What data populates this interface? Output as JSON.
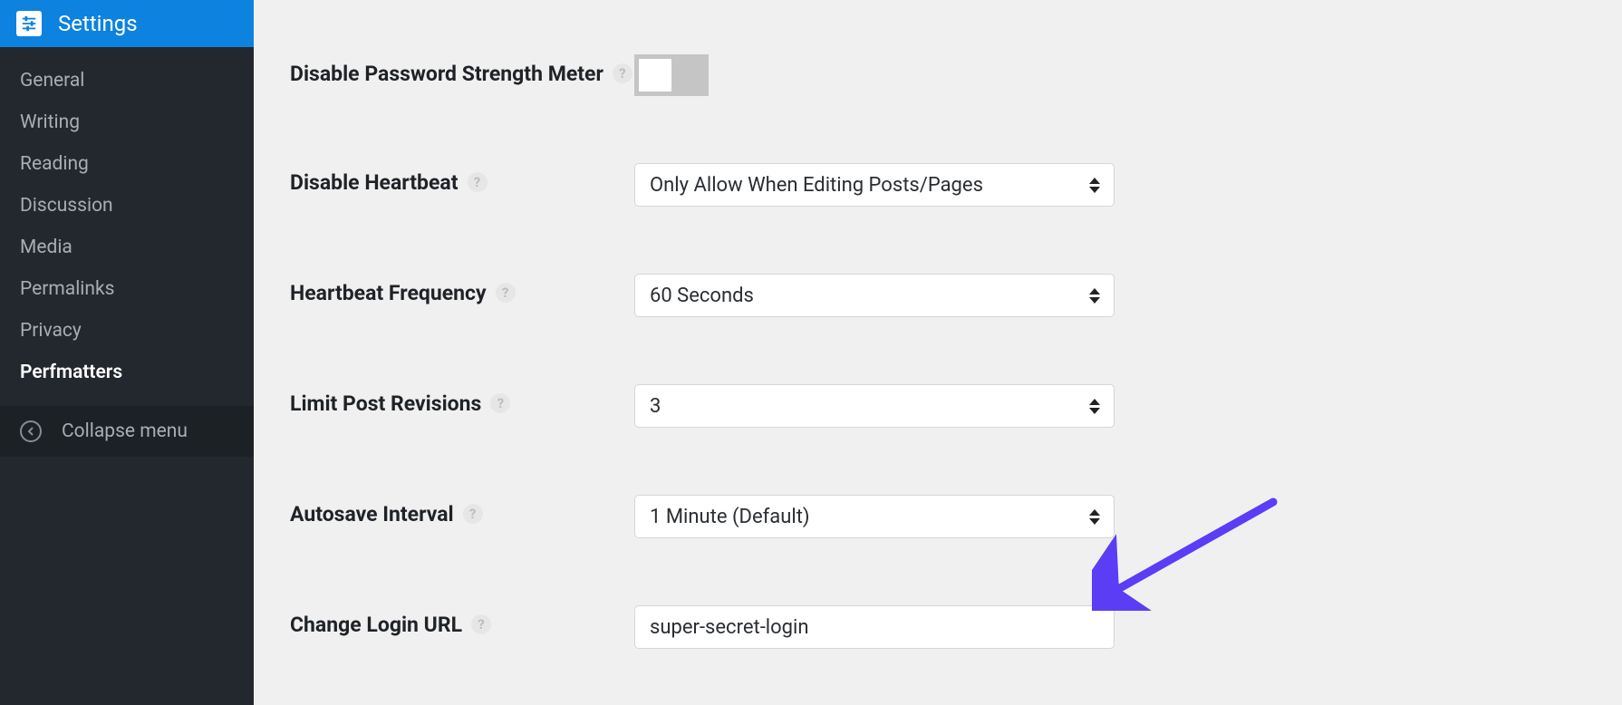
{
  "sidebar": {
    "title": "Settings",
    "items": [
      {
        "label": "General"
      },
      {
        "label": "Writing"
      },
      {
        "label": "Reading"
      },
      {
        "label": "Discussion"
      },
      {
        "label": "Media"
      },
      {
        "label": "Permalinks"
      },
      {
        "label": "Privacy"
      },
      {
        "label": "Perfmatters"
      }
    ],
    "collapse_label": "Collapse menu"
  },
  "form": {
    "password_meter": {
      "label": "Disable Password Strength Meter",
      "checked": false
    },
    "heartbeat": {
      "label": "Disable Heartbeat",
      "value": "Only Allow When Editing Posts/Pages"
    },
    "heartbeat_freq": {
      "label": "Heartbeat Frequency",
      "value": "60 Seconds"
    },
    "revisions": {
      "label": "Limit Post Revisions",
      "value": "3"
    },
    "autosave": {
      "label": "Autosave Interval",
      "value": "1 Minute (Default)"
    },
    "login_url": {
      "label": "Change Login URL",
      "value": "super-secret-login"
    }
  },
  "help_glyph": "?"
}
